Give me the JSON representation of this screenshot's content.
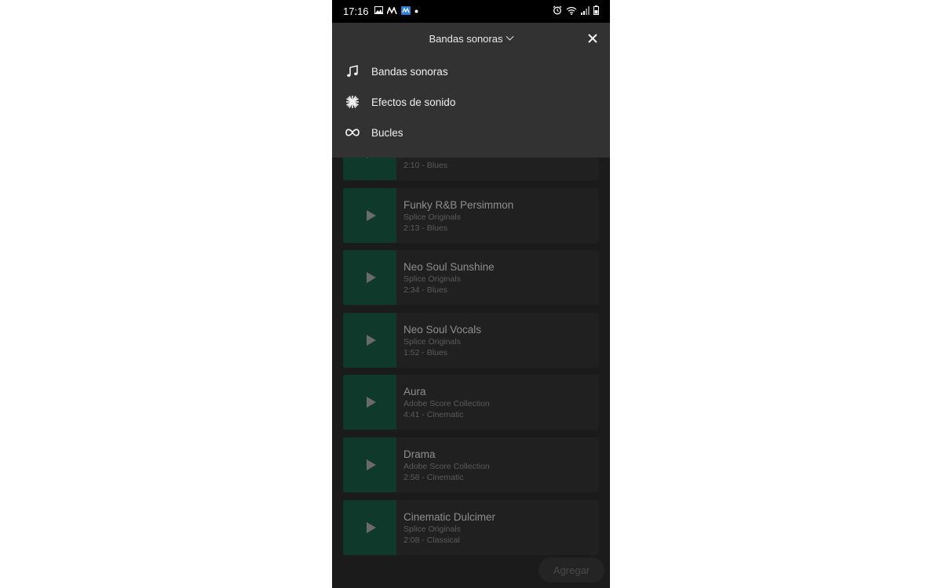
{
  "status_bar": {
    "time": "17:16"
  },
  "menu": {
    "selected": "Bandas sonoras",
    "items": [
      {
        "label": "Bandas sonoras",
        "icon": "music-note-icon"
      },
      {
        "label": "Efectos de sonido",
        "icon": "burst-icon"
      },
      {
        "label": "Bucles",
        "icon": "infinity-icon"
      }
    ]
  },
  "tracks": [
    {
      "title": "",
      "meta": "2:10 - Blues"
    },
    {
      "title": "Funky R&B Persimmon",
      "subtitle": "Splice Originals",
      "meta": "2:13 - Blues"
    },
    {
      "title": "Neo Soul Sunshine",
      "subtitle": "Splice Originals",
      "meta": "2:34 - Blues"
    },
    {
      "title": "Neo Soul Vocals",
      "subtitle": "Splice Originals",
      "meta": "1:52 - Blues"
    },
    {
      "title": "Aura",
      "subtitle": "Adobe Score Collection",
      "meta": "4:41 - Cinematic"
    },
    {
      "title": "Drama",
      "subtitle": "Adobe Score Collection",
      "meta": "2:58 - Cinematic"
    },
    {
      "title": "Cinematic Dulcimer",
      "subtitle": "Splice Originals",
      "meta": "2:08 - Classical"
    }
  ],
  "add_button": "Agregar",
  "colors": {
    "thumb": "#0f3a2b",
    "overlay": "#323232",
    "background": "#1b1b1b"
  }
}
